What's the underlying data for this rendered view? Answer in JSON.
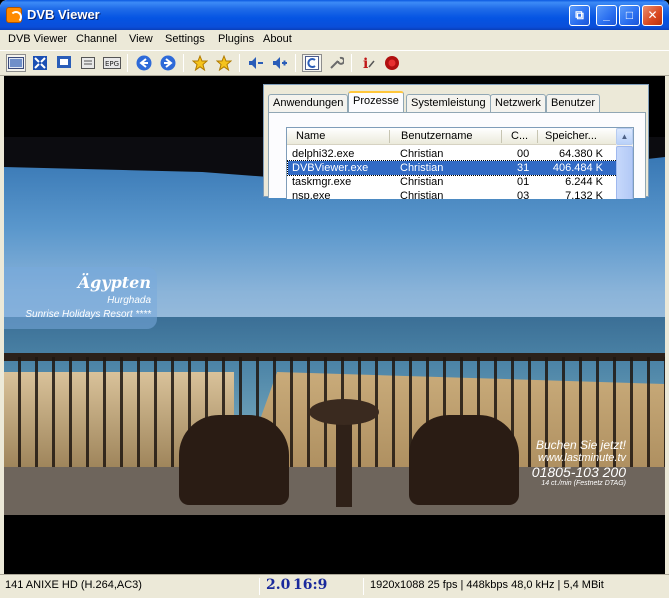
{
  "window": {
    "title": "DVB Viewer"
  },
  "menu": [
    "DVB Viewer",
    "Channel",
    "View",
    "Settings",
    "Plugins",
    "About"
  ],
  "toolbar_icons": [
    "fullscreen-icon",
    "zoom-icon",
    "desktop-icon",
    "osd-icon",
    "epg-icon",
    "back-icon",
    "forward-icon",
    "favorite-icon",
    "favorites-icon",
    "volume-down-icon",
    "volume-up-icon",
    "teletext-icon",
    "tools-icon",
    "info-icon",
    "record-icon"
  ],
  "toolbar_labels": {
    "epg": "EPG"
  },
  "overlay_text": {
    "country": "Ägypten",
    "city": "Hurghada",
    "resort": "Sunrise Holidays Resort ****",
    "ad_line1": "Buchen Sie jetzt!",
    "ad_line2": "www.lastminute.tv",
    "ad_line3": "01805-103 200",
    "ad_line4": "14 ct./min (Festnetz DTAG)"
  },
  "taskmgr": {
    "tabs": [
      "Anwendungen",
      "Prozesse",
      "Systemleistung",
      "Netzwerk",
      "Benutzer"
    ],
    "active_tab": "Prozesse",
    "columns": [
      "Name",
      "Benutzername",
      "C...",
      "Speicher..."
    ],
    "rows": [
      {
        "name": "delphi32.exe",
        "user": "Christian",
        "cpu": "00",
        "mem": "64.380 K",
        "selected": false
      },
      {
        "name": "DVBViewer.exe",
        "user": "Christian",
        "cpu": "31",
        "mem": "406.484 K",
        "selected": true
      },
      {
        "name": "taskmgr.exe",
        "user": "Christian",
        "cpu": "01",
        "mem": "6.244 K",
        "selected": false
      },
      {
        "name": "nsp.exe",
        "user": "Christian",
        "cpu": "03",
        "mem": "7.132 K",
        "selected": false
      }
    ]
  },
  "status": {
    "channel": "141 ANIXE HD (H.264,AC3)",
    "audio": "2.0",
    "aspect": "16:9",
    "info": "1920x1088 25 fps | 448kbps 48,0 kHz | 5,4 MBit"
  },
  "colors": {
    "titlebar": "#0554e3",
    "selection": "#316ac5",
    "status_badge": "#1a2a9c"
  }
}
